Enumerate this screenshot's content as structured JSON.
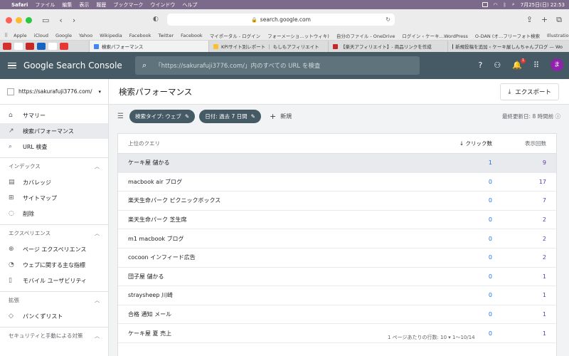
{
  "mac": {
    "app": "Safari",
    "menus": [
      "ファイル",
      "編集",
      "表示",
      "履歴",
      "ブックマーク",
      "ウインドウ",
      "ヘルプ"
    ],
    "datetime": "7月25日(日)  22:53"
  },
  "browser": {
    "address": "search.google.com",
    "bookmarks": [
      "Apple",
      "iCloud",
      "Google",
      "Yahoo",
      "Wikipedia",
      "Facebook",
      "Twitter",
      "Facebook",
      "マイポータル - ログイン",
      "フォーメーショ…ットウィキ)",
      "自分のファイル - OneDrive",
      "ログイン ‹ ケーキ…WordPress",
      "O-DAN (オ…フリーフォト検索",
      "Illustrations | unDraw"
    ],
    "tabs": [
      "検索パフォーマンス",
      "KPIサイト別レポート ｜ もしもアフィリエイト",
      "【楽天アフィリエイト】- 商品リンクを作成",
      "新規投稿を追加 ‹ ケーキ屋しんちゃんブログ — Wo"
    ]
  },
  "header": {
    "logo": "Google Search Console",
    "search_placeholder": "「https://sakurafuji3776.com/」内のすべての URL を検査",
    "notification_count": "1",
    "avatar_letter": "ま"
  },
  "sidebar": {
    "property": "https://sakurafuji3776.com/",
    "top_items": [
      {
        "label": "サマリー",
        "icon": "home-icon"
      },
      {
        "label": "検索パフォーマンス",
        "icon": "trending-icon"
      },
      {
        "label": "URL 検査",
        "icon": "search-icon"
      }
    ],
    "sections": [
      {
        "title": "インデックス",
        "items": [
          "カバレッジ",
          "サイトマップ",
          "削除"
        ]
      },
      {
        "title": "エクスペリエンス",
        "items": [
          "ページ エクスペリエンス",
          "ウェブに関する主な指標",
          "モバイル ユーザビリティ"
        ]
      },
      {
        "title": "拡張",
        "items": [
          "パンくずリスト"
        ]
      },
      {
        "title": "セキュリティと手動による対策",
        "items": []
      }
    ]
  },
  "main": {
    "title": "検索パフォーマンス",
    "export_label": "エクスポート",
    "chips": [
      "検索タイプ: ウェブ",
      "日付: 過去 7 日間"
    ],
    "new_label": "新規",
    "updated": "最終更新日: 8 時間前",
    "table": {
      "headers": {
        "query": "上位のクエリ",
        "clicks": "クリック数",
        "impressions": "表示回数"
      },
      "rows": [
        {
          "query": "ケーキ屋 儲かる",
          "clicks": "1",
          "impressions": "9"
        },
        {
          "query": "macbook air ブログ",
          "clicks": "0",
          "impressions": "17"
        },
        {
          "query": "楽天生命パーク ピクニックボックス",
          "clicks": "0",
          "impressions": "7"
        },
        {
          "query": "楽天生命パーク 芝生席",
          "clicks": "0",
          "impressions": "2"
        },
        {
          "query": "m1 macbook ブログ",
          "clicks": "0",
          "impressions": "2"
        },
        {
          "query": "cocoon インフィード広告",
          "clicks": "0",
          "impressions": "2"
        },
        {
          "query": "団子屋 儲かる",
          "clicks": "0",
          "impressions": "1"
        },
        {
          "query": "straysheep 川崎",
          "clicks": "0",
          "impressions": "1"
        },
        {
          "query": "合格 通知 メール",
          "clicks": "0",
          "impressions": "1"
        },
        {
          "query": "ケーキ屋 夏 売上",
          "clicks": "0",
          "impressions": "1"
        }
      ]
    },
    "pager": "1 ページあたりの行数:  10  ▾     1～10/14"
  }
}
